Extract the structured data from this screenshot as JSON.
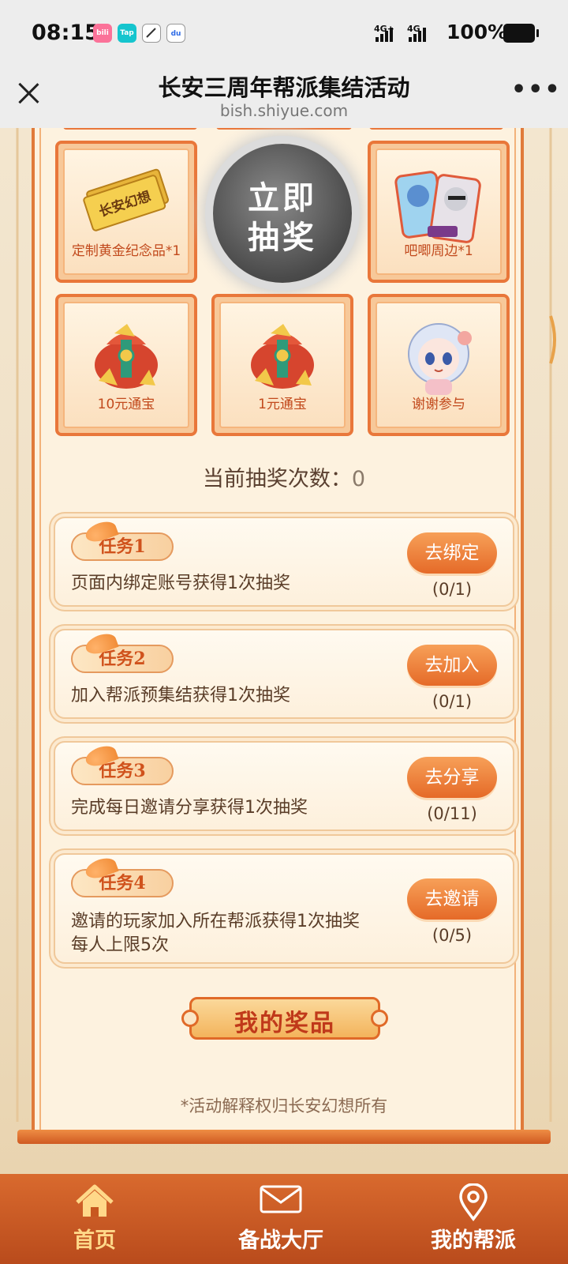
{
  "status_bar": {
    "time": "08:15",
    "apps": [
      {
        "name": "bilibili-icon",
        "label": "bili",
        "color": "#fb7299"
      },
      {
        "name": "taptap-icon",
        "label": "Tap",
        "color": "#15c5ce"
      },
      {
        "name": "edge-app-icon",
        "label": "",
        "color": "#ffffff"
      },
      {
        "name": "baidu-icon",
        "label": "du",
        "color": "#ffffff"
      }
    ],
    "network_1": "4G+",
    "network_2": "4G",
    "battery": "100%"
  },
  "browser": {
    "title": "长安三周年帮派集结活动",
    "url": "bish.shiyue.com"
  },
  "prizes": {
    "gold_souvenir": "定制黄金纪念品*1",
    "merch": "吧唧周边*1",
    "ten_yuan": "10元通宝",
    "one_yuan": "1元通宝",
    "thanks": "谢谢参与",
    "ticket_text": "长安幻想"
  },
  "draw_button": {
    "line1": "立即",
    "line2": "抽奖"
  },
  "draw_count": {
    "label": "当前抽奖次数：",
    "value": "0"
  },
  "tasks": [
    {
      "tag": "任务1",
      "desc": "页面内绑定账号获得1次抽奖",
      "desc2": "",
      "button": "去绑定",
      "progress": "(0/1)"
    },
    {
      "tag": "任务2",
      "desc": "加入帮派预集结获得1次抽奖",
      "desc2": "",
      "button": "去加入",
      "progress": "(0/1)"
    },
    {
      "tag": "任务3",
      "desc": "完成每日邀请分享获得1次抽奖",
      "desc2": "",
      "button": "去分享",
      "progress": "(0/11)"
    },
    {
      "tag": "任务4",
      "desc": "邀请的玩家加入所在帮派获得1次抽奖",
      "desc2": "每人上限5次",
      "button": "去邀请",
      "progress": "(0/5)"
    }
  ],
  "my_prizes": "我的奖品",
  "footnote": "*活动解释权归长安幻想所有",
  "nav": [
    {
      "label": "首页",
      "active": true
    },
    {
      "label": "备战大厅",
      "active": false
    },
    {
      "label": "我的帮派",
      "active": false
    }
  ],
  "colors": {
    "accent": "#e56a28",
    "nav_bg": "#c8571f",
    "active_nav": "#ffd889"
  }
}
